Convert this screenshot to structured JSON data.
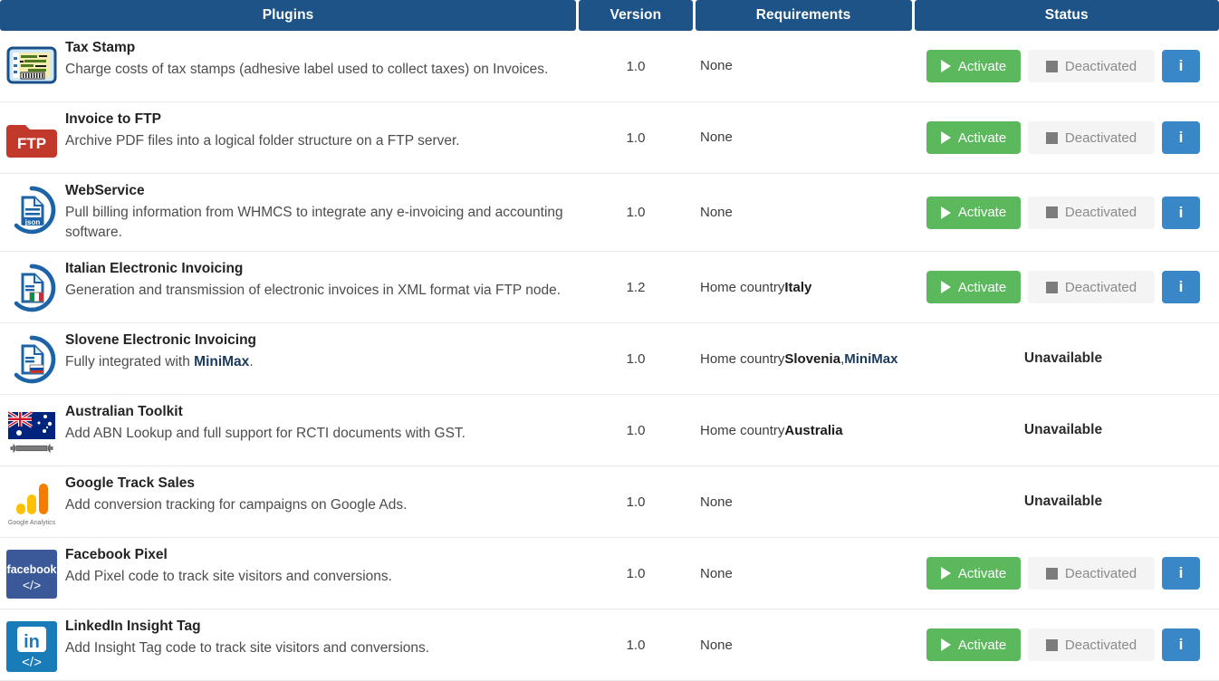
{
  "table": {
    "columns": [
      {
        "key": "plugins",
        "label": "Plugins"
      },
      {
        "key": "version",
        "label": "Version"
      },
      {
        "key": "requirements",
        "label": "Requirements"
      },
      {
        "key": "status",
        "label": "Status"
      }
    ],
    "buttons": {
      "activate_label": "Activate",
      "deactivated_label": "Deactivated",
      "info_label": "i",
      "unavailable_label": "Unavailable"
    },
    "colors": {
      "header_bg": "#1d5386",
      "activate_green": "#5cb85c",
      "deactivated_gray": "#f4f4f4",
      "info_blue": "#3a87c8",
      "row_divider": "#eaeaea"
    },
    "rows": [
      {
        "icon": "tax-stamp-icon",
        "title": "Tax Stamp",
        "description": "Charge costs of tax stamps (adhesive label used to collect taxes) on Invoices.",
        "version": "1.0",
        "requirements": "None",
        "status": "buttons"
      },
      {
        "icon": "ftp-folder-icon",
        "title": "Invoice to FTP",
        "description": "Archive PDF files into a logical folder structure on a FTP server.",
        "version": "1.0",
        "requirements": "None",
        "status": "buttons"
      },
      {
        "icon": "json-document-icon",
        "title": "WebService",
        "description": "Pull billing information from WHMCS to integrate any e-invoicing and accounting software.",
        "version": "1.0",
        "requirements": "None",
        "status": "buttons"
      },
      {
        "icon": "italy-document-icon",
        "title": "Italian Electronic Invoicing",
        "description": "Generation and transmission of electronic invoices in XML format via FTP node.",
        "version": "1.2",
        "requirements": "Home country Italy",
        "requirements_prefix": "Home country ",
        "requirements_bold": "Italy",
        "status": "buttons"
      },
      {
        "icon": "slovenia-document-icon",
        "title": "Slovene Electronic Invoicing",
        "description": "Fully integrated with MiniMax.",
        "description_prefix": "Fully integrated with ",
        "description_bold": "MiniMax",
        "description_suffix": ".",
        "version": "1.0",
        "requirements": "Home country Slovenia, MiniMax",
        "requirements_prefix": "Home country ",
        "requirements_bold": "Slovenia",
        "requirements_mid": ", ",
        "requirements_bold2": "MiniMax",
        "status": "unavailable"
      },
      {
        "icon": "australia-wrench-icon",
        "title": "Australian Toolkit",
        "description": "Add ABN Lookup and full support for RCTI documents with GST.",
        "version": "1.0",
        "requirements": "Home country Australia",
        "requirements_prefix": "Home country ",
        "requirements_bold": "Australia",
        "status": "unavailable"
      },
      {
        "icon": "google-analytics-icon",
        "title": "Google Track Sales",
        "description": "Add conversion tracking for campaigns on Google Ads.",
        "version": "1.0",
        "requirements": "None",
        "status": "unavailable"
      },
      {
        "icon": "facebook-pixel-icon",
        "title": "Facebook Pixel",
        "description": "Add Pixel code to track site visitors and conversions.",
        "version": "1.0",
        "requirements": "None",
        "status": "buttons"
      },
      {
        "icon": "linkedin-insight-icon",
        "title": "LinkedIn Insight Tag",
        "description": "Add Insight Tag code to track site visitors and conversions.",
        "version": "1.0",
        "requirements": "None",
        "status": "buttons"
      }
    ]
  },
  "icon_text": {
    "ftp": "FTP",
    "json": "json",
    "google_analytics": "Google Analytics",
    "facebook": "facebook",
    "code": "&lt;/&gt;",
    "linkedin": "in"
  }
}
